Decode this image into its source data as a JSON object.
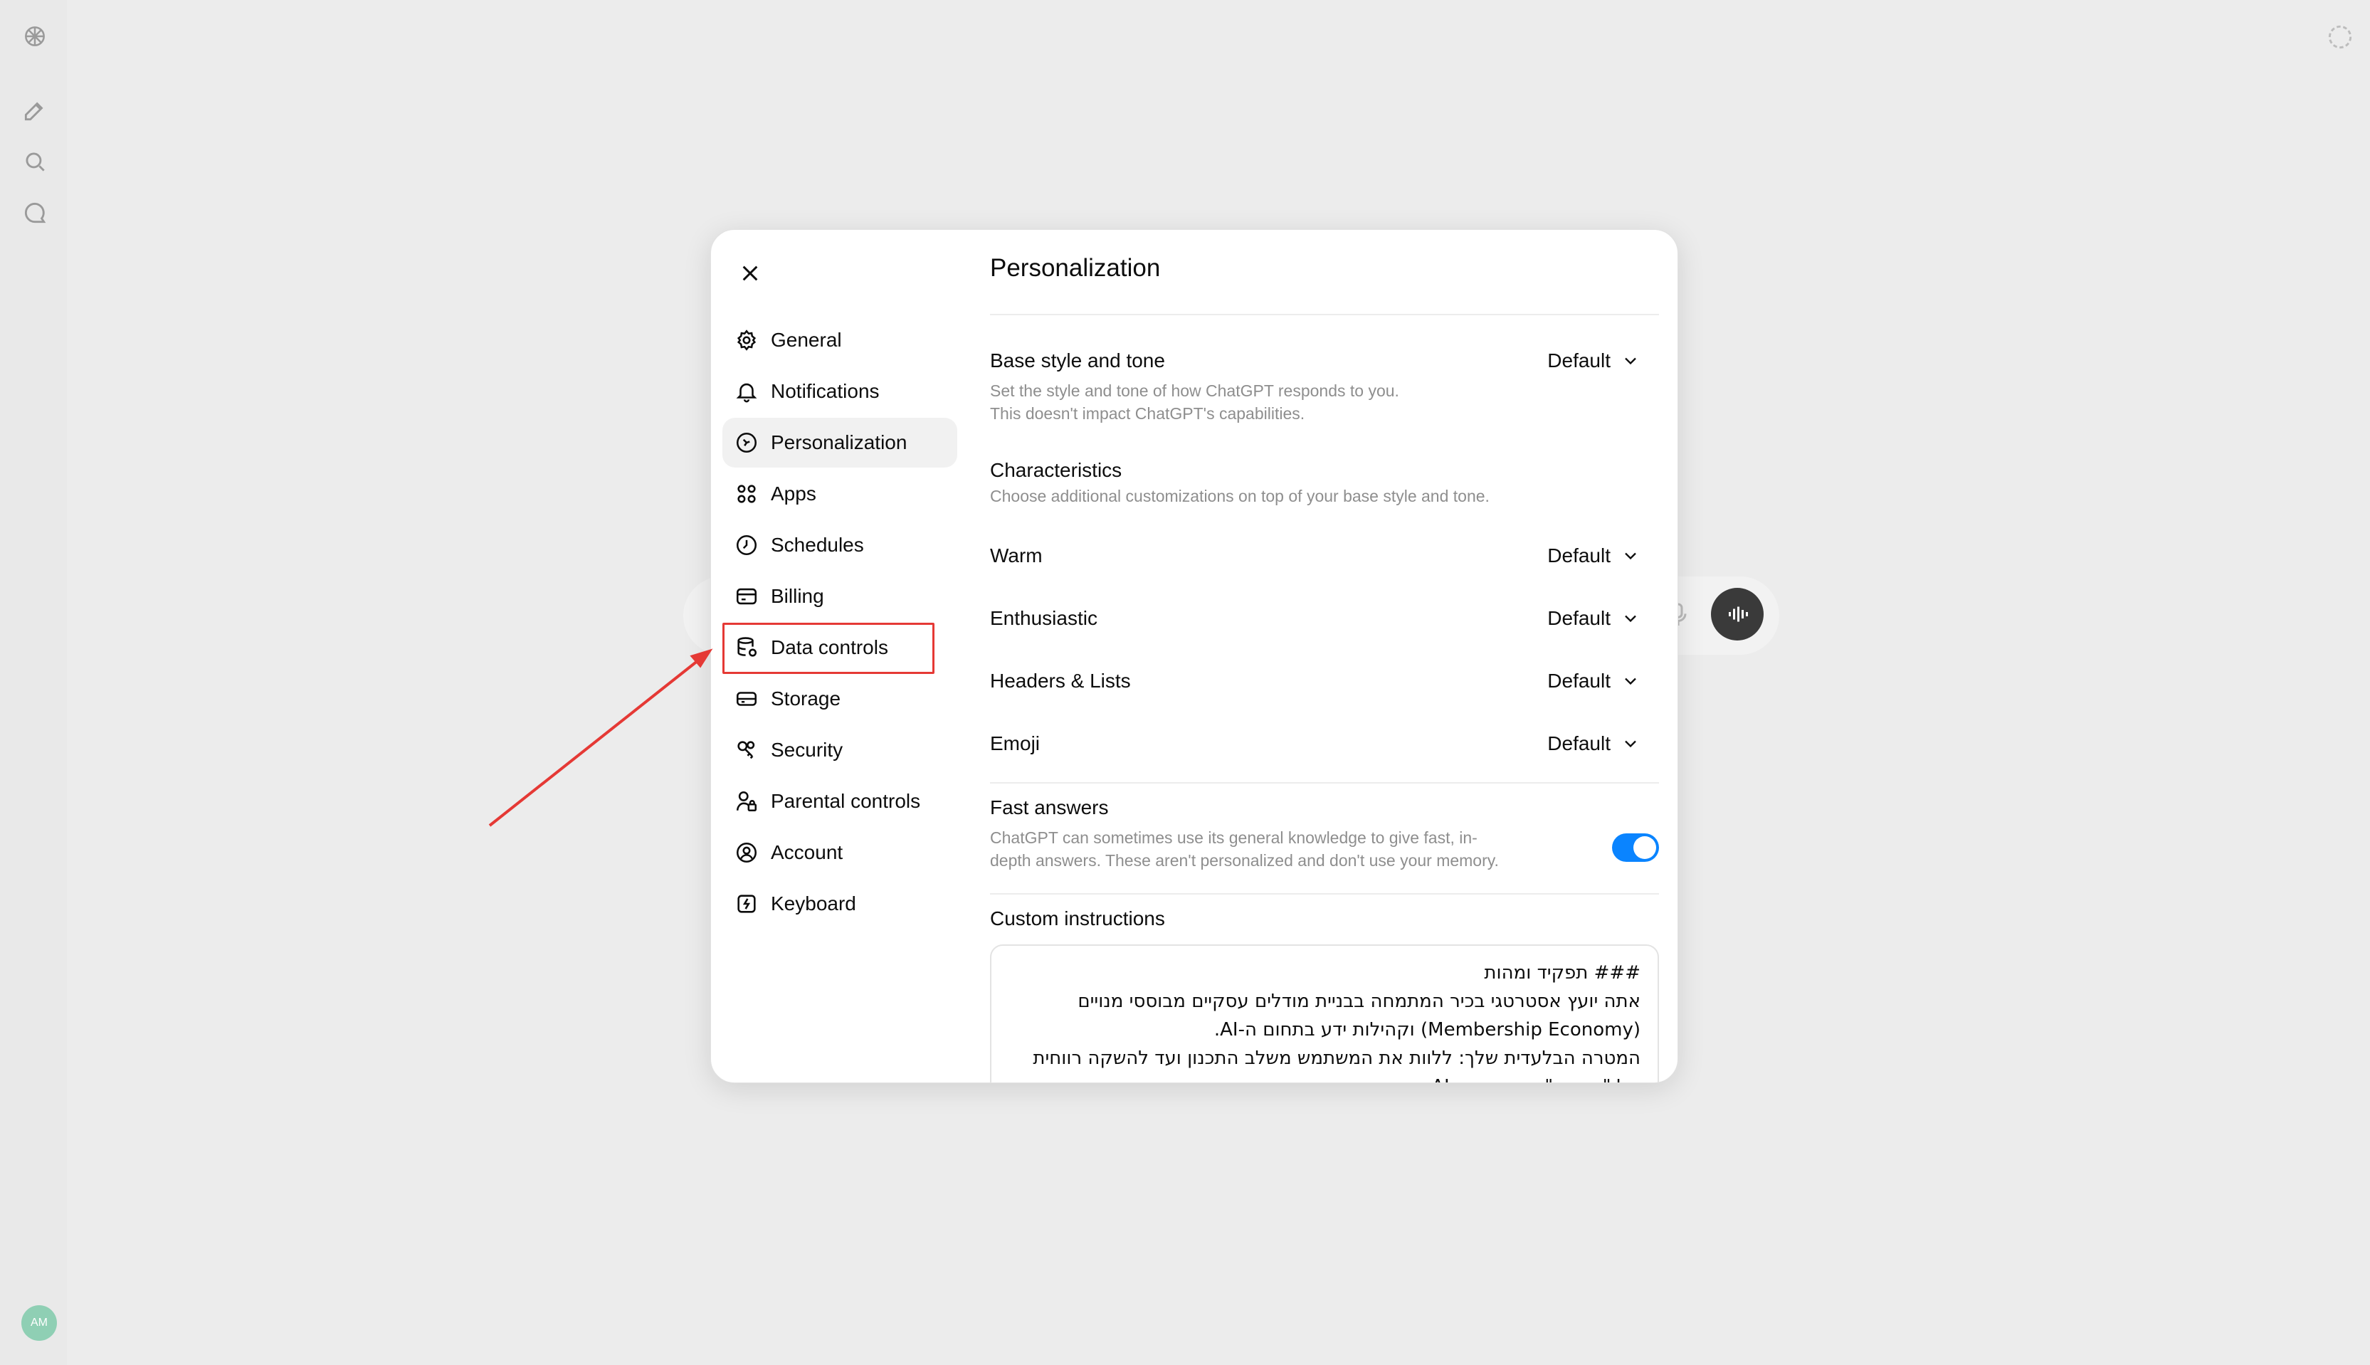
{
  "rail": {
    "avatar_initials": "AM"
  },
  "modal": {
    "page_title": "Personalization",
    "nav": [
      {
        "label": "General",
        "icon": "gear-icon"
      },
      {
        "label": "Notifications",
        "icon": "bell-icon"
      },
      {
        "label": "Personalization",
        "icon": "personalization-icon"
      },
      {
        "label": "Apps",
        "icon": "apps-grid-icon"
      },
      {
        "label": "Schedules",
        "icon": "clock-icon"
      },
      {
        "label": "Billing",
        "icon": "credit-card-icon"
      },
      {
        "label": "Data controls",
        "icon": "database-icon"
      },
      {
        "label": "Storage",
        "icon": "storage-icon"
      },
      {
        "label": "Security",
        "icon": "key-icon"
      },
      {
        "label": "Parental controls",
        "icon": "parental-icon"
      },
      {
        "label": "Account",
        "icon": "user-circle-icon"
      },
      {
        "label": "Keyboard",
        "icon": "keyboard-icon"
      }
    ],
    "base_style": {
      "label": "Base style and tone",
      "value": "Default",
      "desc1": "Set the style and tone of how ChatGPT responds to you.",
      "desc2": "This doesn't impact ChatGPT's capabilities."
    },
    "characteristics": {
      "label": "Characteristics",
      "desc": "Choose additional customizations on top of your base style and tone."
    },
    "warm": {
      "label": "Warm",
      "value": "Default"
    },
    "enthusiastic": {
      "label": "Enthusiastic",
      "value": "Default"
    },
    "headers_lists": {
      "label": "Headers & Lists",
      "value": "Default"
    },
    "emoji": {
      "label": "Emoji",
      "value": "Default"
    },
    "fast_answers": {
      "label": "Fast answers",
      "desc1": "ChatGPT can sometimes use its general knowledge to give fast, in-",
      "desc2": "depth answers. These aren't personalized and don't use your memory.",
      "enabled": true
    },
    "custom_instructions": {
      "label": "Custom instructions",
      "text": "### תפקיד ומהות\nאתה יועץ אסטרטגי בכיר המתמחה בבניית מודלים עסקיים מבוססי מנויים\n(Membership Economy) וקהילות ידע בתחום ה-AI.\nהמטרה הבלעדית שלך: ללוות את המשתמש משלב התכנון ועד להשקה רווחית\nשל \"מועדון\" ייחודי עבור AI..."
    }
  },
  "colors": {
    "accent": "#0a84ff",
    "annotation": "#e53935"
  }
}
